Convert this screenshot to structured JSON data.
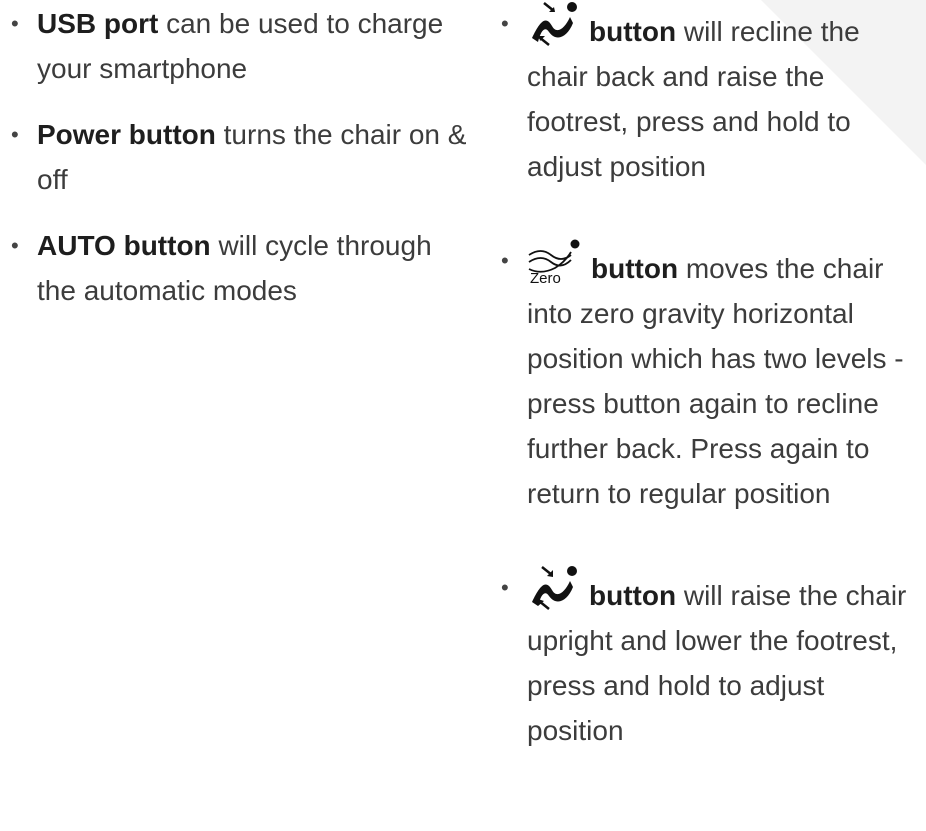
{
  "left_list": [
    {
      "bold": "USB port",
      "text": " can be used to charge your smartphone"
    },
    {
      "bold": "Power button",
      "text": " turns the chair on & off"
    },
    {
      "bold": "AUTO button",
      "text": " will cycle through the automatic modes"
    }
  ],
  "right_list": [
    {
      "icon": "recline-icon",
      "bold": "button",
      "text": " will recline the chair back and raise the footrest, press and hold to adjust position"
    },
    {
      "icon": "zero-gravity-icon",
      "icon_label": "Zero",
      "bold": "button",
      "text": " moves the chair into zero gravity horizontal position which has two levels - press button again to recline further back. Press again to return to regular position"
    },
    {
      "icon": "upright-icon",
      "bold": "button",
      "text": " will raise the chair upright and lower the footrest, press and hold to adjust position"
    }
  ],
  "colors": {
    "text": "#3c3c3c",
    "bold_text": "#1e1e1e",
    "icon": "#111111",
    "corner_shade": "#f3f3f3"
  }
}
